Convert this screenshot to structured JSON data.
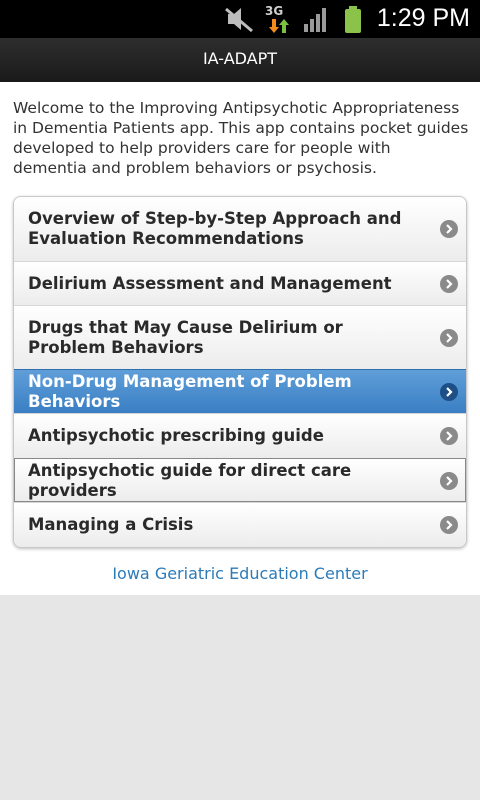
{
  "status_bar": {
    "time": "1:29 PM",
    "icons": [
      "mute-icon",
      "3g-data-icon",
      "signal-icon",
      "battery-icon"
    ],
    "network_label": "3G"
  },
  "header": {
    "title": "IA-ADAPT"
  },
  "intro": "Welcome to the Improving Antipsychotic Appropriateness in Dementia Patients app. This app contains pocket guides developed to help providers care for people with dementia and problem behaviors or psychosis.",
  "menu": {
    "items": [
      {
        "label": "Overview of Step-by-Step Approach and Evaluation Recommendations"
      },
      {
        "label": "Delirium Assessment and Management"
      },
      {
        "label": "Drugs that May Cause Delirium or Problem Behaviors"
      },
      {
        "label": "Non-Drug Management of Problem Behaviors"
      },
      {
        "label": "Antipsychotic prescribing guide"
      },
      {
        "label": "Antipsychotic guide for direct care providers"
      },
      {
        "label": "Managing a Crisis"
      }
    ]
  },
  "footer": {
    "link": "Iowa Geriatric Education Center"
  },
  "colors": {
    "active_item": "#4a8fd0",
    "link": "#2b7bb9",
    "battery": "#8bc34a"
  }
}
